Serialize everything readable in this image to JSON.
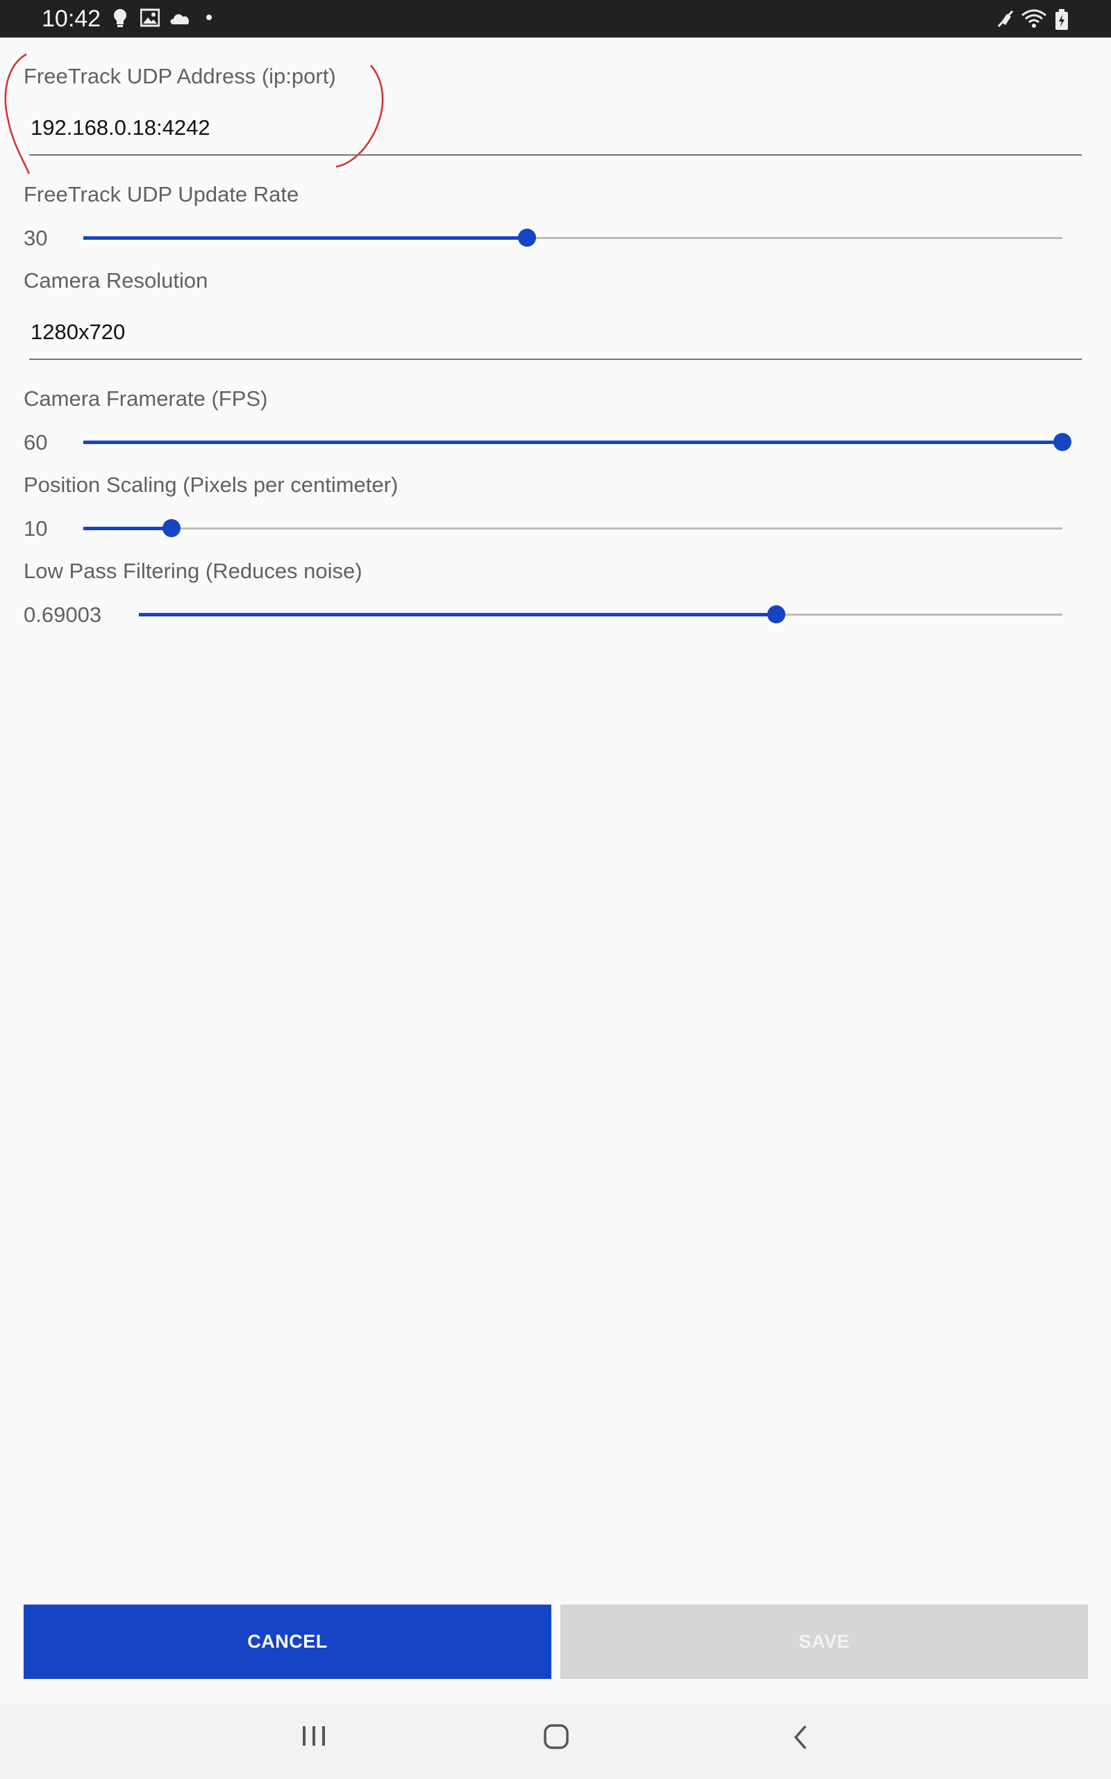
{
  "status_bar": {
    "time": "10:42",
    "left_icons": [
      "bulb-icon",
      "image-icon",
      "cloud-icon",
      "dot-icon"
    ],
    "right_icons": [
      "mute-icon",
      "wifi-icon",
      "battery-icon"
    ]
  },
  "settings": {
    "udp_address": {
      "label": "FreeTrack UDP Address (ip:port)",
      "value": "192.168.0.18:4242"
    },
    "udp_rate": {
      "label": "FreeTrack UDP Update Rate",
      "value": "30",
      "fraction": 0.453
    },
    "camera_resolution": {
      "label": "Camera Resolution",
      "value": "1280x720"
    },
    "camera_framerate": {
      "label": "Camera Framerate (FPS)",
      "value": "60",
      "fraction": 1.0
    },
    "position_scaling": {
      "label": "Position Scaling (Pixels per centimeter)",
      "value": "10",
      "fraction": 0.09
    },
    "low_pass": {
      "label": "Low Pass Filtering (Reduces noise)",
      "value": "0.69003",
      "fraction": 0.69
    }
  },
  "buttons": {
    "cancel": "CANCEL",
    "save": "SAVE"
  },
  "nav_bar": {
    "icons": [
      "recent-apps-icon",
      "home-icon",
      "back-icon"
    ]
  },
  "colors": {
    "accent": "#1545c4",
    "track": "#bdbdbd",
    "annotation": "#d32f2f",
    "disabled_button": "#d6d6d6"
  }
}
